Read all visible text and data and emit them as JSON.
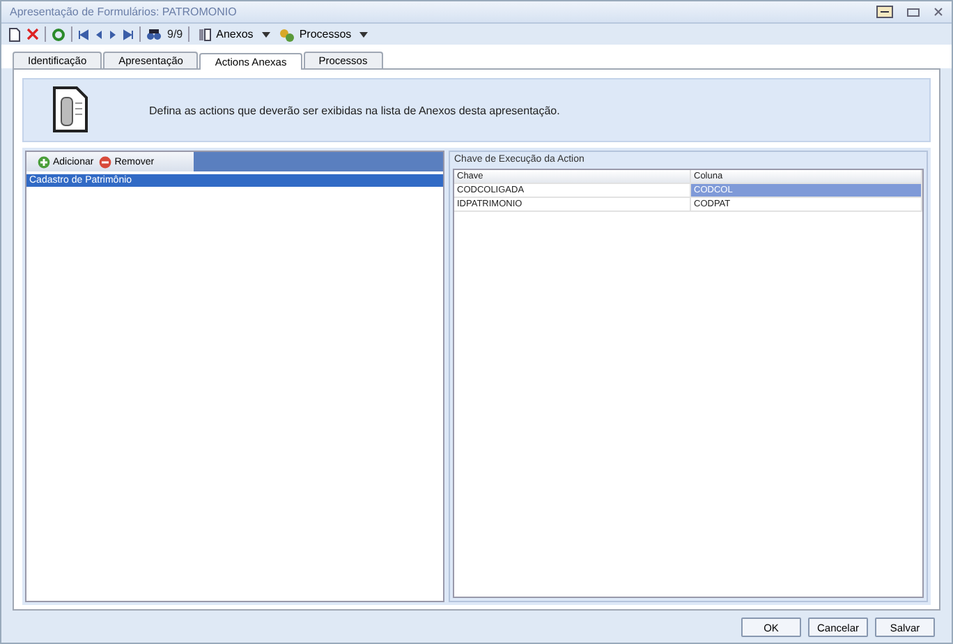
{
  "window": {
    "title": "Apresentação de Formulários: PATROMONIO"
  },
  "toolbar": {
    "record": "9/9",
    "anexos": "Anexos",
    "processos": "Processos"
  },
  "tabs": [
    {
      "label": "Identificação",
      "selected": false
    },
    {
      "label": "Apresentação",
      "selected": false
    },
    {
      "label": "Actions Anexas",
      "selected": true
    },
    {
      "label": "Processos",
      "selected": false
    }
  ],
  "header": {
    "text": "Defina as actions que deverão ser exibidas na lista de Anexos desta apresentação."
  },
  "actions": {
    "buttons": [
      {
        "label": "Adicionar",
        "kind": "add"
      },
      {
        "label": "Remover",
        "kind": "remove"
      }
    ],
    "items": [
      {
        "label": "Cadastro de Patrimônio",
        "selected": true
      }
    ]
  },
  "keys": {
    "title": "Chave de Execução da Action",
    "columns": [
      "Chave",
      "Coluna"
    ],
    "rows": [
      {
        "cells": [
          "CODCOLIGADA",
          "CODCOL"
        ],
        "selected": true
      },
      {
        "cells": [
          "IDPATRIMONIO",
          "CODPAT"
        ],
        "selected": false
      }
    ]
  },
  "footer": {
    "buttons": [
      "OK",
      "Cancelar",
      "Salvar"
    ]
  }
}
